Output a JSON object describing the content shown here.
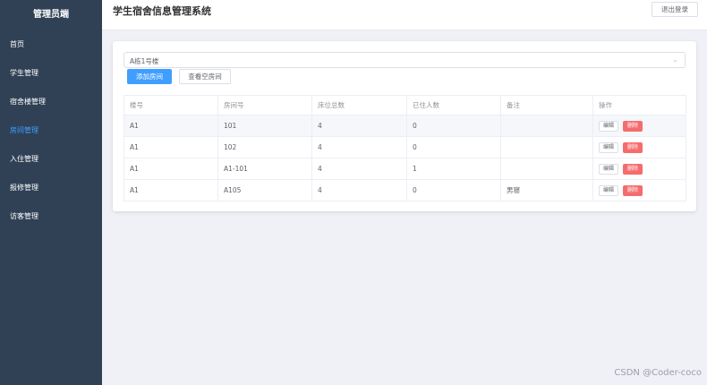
{
  "sidebar": {
    "brand": "管理员端",
    "items": [
      {
        "label": "首页",
        "active": false
      },
      {
        "label": "学生管理",
        "active": false
      },
      {
        "label": "宿舍楼管理",
        "active": false
      },
      {
        "label": "房间管理",
        "active": true
      },
      {
        "label": "入住管理",
        "active": false
      },
      {
        "label": "报修管理",
        "active": false
      },
      {
        "label": "访客管理",
        "active": false
      }
    ]
  },
  "header": {
    "title": "学生宿舍信息管理系统",
    "logout_label": "退出登录"
  },
  "main": {
    "building_select": {
      "value": "A栋1号楼",
      "icon": "chevron-down-icon"
    },
    "add_room_label": "添加房间",
    "view_empty_label": "查看空房间",
    "table": {
      "columns": [
        "楼号",
        "房间号",
        "床位总数",
        "已住人数",
        "备注",
        "操作"
      ],
      "rows": [
        [
          "A1",
          "101",
          "4",
          "0",
          ""
        ],
        [
          "A1",
          "102",
          "4",
          "0",
          ""
        ],
        [
          "A1",
          "A1-101",
          "4",
          "1",
          ""
        ],
        [
          "A1",
          "A105",
          "4",
          "0",
          "男寝"
        ]
      ],
      "edit_label": "编辑",
      "delete_label": "删除"
    }
  },
  "watermark": "CSDN @Coder-coco",
  "colors": {
    "sidebar_bg": "#304156",
    "active": "#409eff",
    "primary": "#409eff",
    "danger": "#f56c6c",
    "page_bg": "#f0f1f6"
  }
}
